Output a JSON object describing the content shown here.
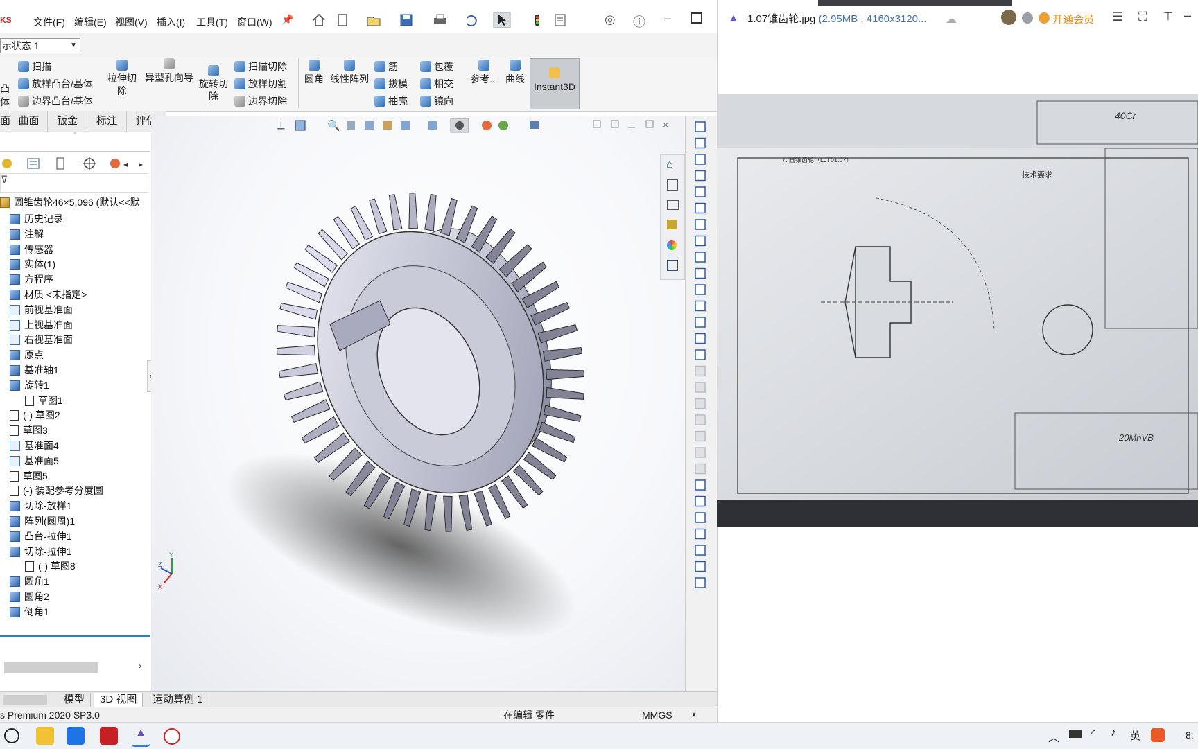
{
  "menubar": {
    "app_fragment": "KS",
    "items": [
      "文件(F)",
      "编辑(E)",
      "视图(V)",
      "插入(I)",
      "工具(T)",
      "窗口(W)"
    ]
  },
  "config": {
    "selector": "示状态 1"
  },
  "ribbon": {
    "col1": [
      "扫描",
      "放样凸台/基体",
      "边界凸台/基体"
    ],
    "col1_left": [
      "凸",
      "体"
    ],
    "cut_extrude": "拉伸切除",
    "hole_wizard": "异型孔向导",
    "revolve_cut": "旋转切除",
    "col2": [
      "扫描切除",
      "放样切割",
      "边界切除"
    ],
    "fillet": "圆角",
    "linear_pattern": "线性阵列",
    "col3": [
      "筋",
      "拔模",
      "抽壳"
    ],
    "col4": [
      "包覆",
      "相交",
      "镜向"
    ],
    "reference": "参考...",
    "curves": "曲线",
    "instant3d": "Instant3D"
  },
  "tabs": [
    "面",
    "曲面",
    "钣金",
    "标注",
    "评估"
  ],
  "tree": {
    "root": "圆锥齿轮46×5.096 (默认<<默",
    "items": [
      {
        "label": "历史记录",
        "icon": "history-icon",
        "indent": 0
      },
      {
        "label": "注解",
        "icon": "annotation-icon",
        "indent": 0
      },
      {
        "label": "传感器",
        "icon": "sensor-icon",
        "indent": 0
      },
      {
        "label": "实体(1)",
        "icon": "solid-body-icon",
        "indent": 0
      },
      {
        "label": "方程序",
        "icon": "equation-icon",
        "indent": 0
      },
      {
        "label": "材质 <未指定>",
        "icon": "material-icon",
        "indent": 0
      },
      {
        "label": "前视基准面",
        "icon": "plane-icon",
        "indent": 0
      },
      {
        "label": "上视基准面",
        "icon": "plane-icon",
        "indent": 0
      },
      {
        "label": "右视基准面",
        "icon": "plane-icon",
        "indent": 0
      },
      {
        "label": "原点",
        "icon": "origin-icon",
        "indent": 0
      },
      {
        "label": "基准轴1",
        "icon": "axis-icon",
        "indent": 0
      },
      {
        "label": "旋转1",
        "icon": "revolve-icon",
        "indent": 0
      },
      {
        "label": "草图1",
        "icon": "sketch-icon",
        "indent": 1
      },
      {
        "label": "(-) 草图2",
        "icon": "sketch-icon",
        "indent": 0
      },
      {
        "label": "草图3",
        "icon": "sketch-icon",
        "indent": 0
      },
      {
        "label": "基准面4",
        "icon": "plane-icon",
        "indent": 0
      },
      {
        "label": "基准面5",
        "icon": "plane-icon",
        "indent": 0
      },
      {
        "label": "草图5",
        "icon": "sketch-icon",
        "indent": 0
      },
      {
        "label": "(-) 装配参考分度圆",
        "icon": "sketch-icon",
        "indent": 0
      },
      {
        "label": "切除-放样1",
        "icon": "loft-cut-icon",
        "indent": 0
      },
      {
        "label": "阵列(圆周)1",
        "icon": "circular-pattern-icon",
        "indent": 0
      },
      {
        "label": "凸台-拉伸1",
        "icon": "extrude-icon",
        "indent": 0
      },
      {
        "label": "切除-拉伸1",
        "icon": "cut-extrude-icon",
        "indent": 0
      },
      {
        "label": "(-) 草图8",
        "icon": "sketch-icon",
        "indent": 1
      },
      {
        "label": "圆角1",
        "icon": "fillet-icon",
        "indent": 0
      },
      {
        "label": "圆角2",
        "icon": "fillet-icon",
        "indent": 0
      },
      {
        "label": "倒角1",
        "icon": "chamfer-icon",
        "indent": 0
      }
    ]
  },
  "bottom_tabs": [
    "模型",
    "3D 视图",
    "运动算例 1"
  ],
  "status": {
    "version": "s Premium 2020 SP3.0",
    "mode": "在编辑 零件",
    "units": "MMGS"
  },
  "viewer": {
    "filename": "1.07锥齿轮.jpg",
    "meta": "(2.95MB , 4160x3120...",
    "vip": "开通会员"
  },
  "drawing": {
    "header": "7. 圆锥齿轮（LJT01.07）",
    "tech_title": "技术要求",
    "material_top": "40Cr",
    "material": "20MnVB"
  },
  "taskbar": {
    "clock": "8:"
  }
}
